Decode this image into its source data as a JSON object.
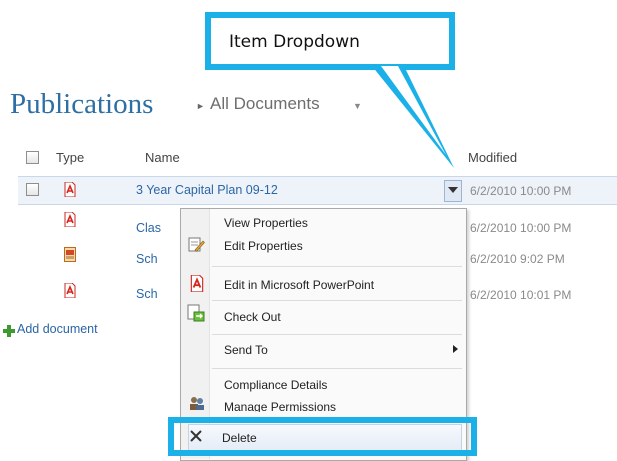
{
  "callout": {
    "label": "Item Dropdown"
  },
  "page": {
    "title": "Publications",
    "view": "All Documents"
  },
  "columns": {
    "type": "Type",
    "name": "Name",
    "modified": "Modified"
  },
  "rows": [
    {
      "name": "3 Year Capital Plan 09-12",
      "modified": "6/2/2010 10:00 PM",
      "icon": "pdf-icon"
    },
    {
      "name": "Clas",
      "modified": "6/2/2010 10:00 PM",
      "icon": "pdf-icon"
    },
    {
      "name": "Sch",
      "modified": "6/2/2010 9:02 PM",
      "icon": "powerpoint-icon"
    },
    {
      "name": "Sch",
      "modified": "6/2/2010 10:01 PM",
      "icon": "pdf-icon"
    }
  ],
  "add_document": "Add document",
  "menu": {
    "view_properties": "View Properties",
    "edit_properties": "Edit Properties",
    "edit_in_powerpoint": "Edit in Microsoft PowerPoint",
    "check_out": "Check Out",
    "send_to": "Send To",
    "compliance_details": "Compliance Details",
    "manage_permissions": "Manage Permissions",
    "delete": "Delete"
  },
  "colors": {
    "accent": "#1bb0e8",
    "title": "#2d6fa4",
    "link": "#2b66a6"
  }
}
